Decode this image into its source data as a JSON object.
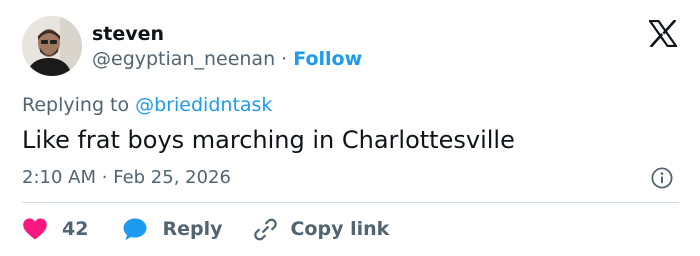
{
  "user": {
    "display_name": "steven",
    "handle": "@egyptian_neenan",
    "separator": "·",
    "follow_label": "Follow"
  },
  "replying": {
    "prefix": "Replying to ",
    "target": "@briedidntask"
  },
  "tweet": {
    "text": "Like frat boys marching in Charlottesville",
    "time": "2:10 AM",
    "separator": "·",
    "date": "Feb 25, 2026"
  },
  "actions": {
    "like_count": "42",
    "reply_label": "Reply",
    "copy_link_label": "Copy link"
  },
  "colors": {
    "accent": "#1d9bf0",
    "like": "#f91880",
    "secondary_text": "#536471",
    "primary_text": "#0f1419"
  },
  "icons": [
    "x-logo-icon",
    "info-icon",
    "heart-icon",
    "reply-bubble-icon",
    "link-icon"
  ]
}
